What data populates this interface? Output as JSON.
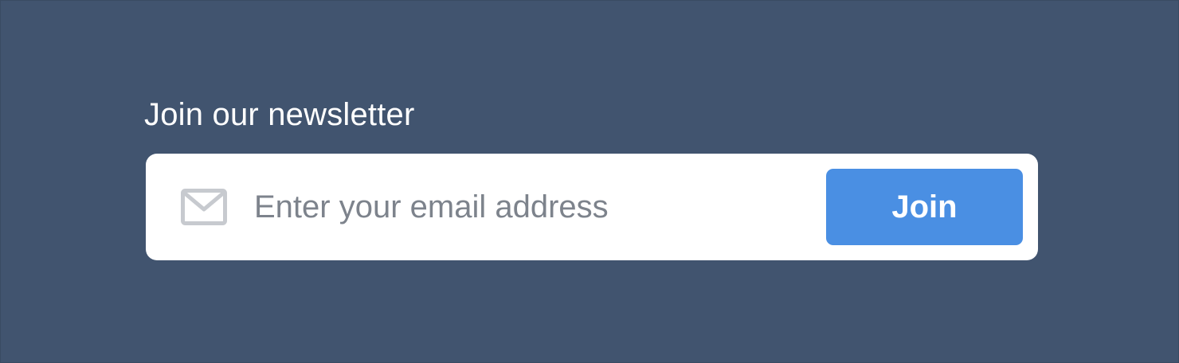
{
  "newsletter": {
    "heading": "Join our newsletter",
    "email_placeholder": "Enter your email address",
    "email_value": "",
    "submit_label": "Join",
    "icon": "mail-icon"
  },
  "colors": {
    "background": "#41546f",
    "card": "#ffffff",
    "accent": "#4a8fe3",
    "icon": "#c7cacf",
    "placeholder": "#7d838c"
  }
}
